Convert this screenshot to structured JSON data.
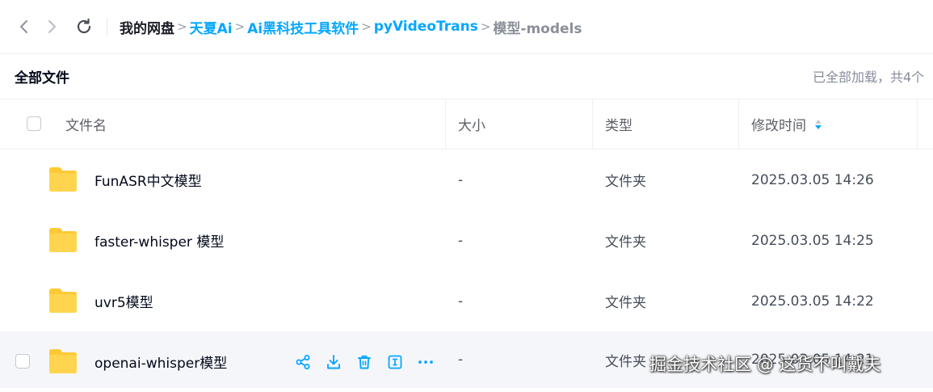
{
  "nav": {
    "back_icon": "chevron-left-icon",
    "forward_icon": "chevron-right-icon",
    "refresh_icon": "refresh-icon"
  },
  "breadcrumb": {
    "items": [
      {
        "label": "我的网盘"
      },
      {
        "label": "天夏Ai"
      },
      {
        "label": "Ai黑科技工具软件"
      },
      {
        "label": "pyVideoTrans"
      },
      {
        "label": "模型-models"
      }
    ],
    "separator": ">"
  },
  "subheader": {
    "title": "全部文件",
    "status": "已全部加载，共4个"
  },
  "table": {
    "columns": {
      "name": "文件名",
      "size": "大小",
      "type": "类型",
      "modified": "修改时间"
    },
    "rows": [
      {
        "name": "FunASR中文模型",
        "size": "-",
        "type": "文件夹",
        "modified": "2025.03.05 14:26"
      },
      {
        "name": "faster-whisper 模型",
        "size": "-",
        "type": "文件夹",
        "modified": "2025.03.05 14:25"
      },
      {
        "name": "uvr5模型",
        "size": "-",
        "type": "文件夹",
        "modified": "2025.03.05 14:22"
      },
      {
        "name": "openai-whisper模型",
        "size": "-",
        "type": "文件夹",
        "modified": "2025.03.05 14:21"
      }
    ]
  },
  "row_actions": [
    "share-icon",
    "download-icon",
    "delete-icon",
    "rename-icon",
    "more-icon"
  ],
  "watermark": "掘金技术社区 @ 这货不叫戴夫",
  "colors": {
    "accent": "#06a7ff",
    "folder": "#ffc935",
    "hover_row": "#f5f6f9"
  }
}
